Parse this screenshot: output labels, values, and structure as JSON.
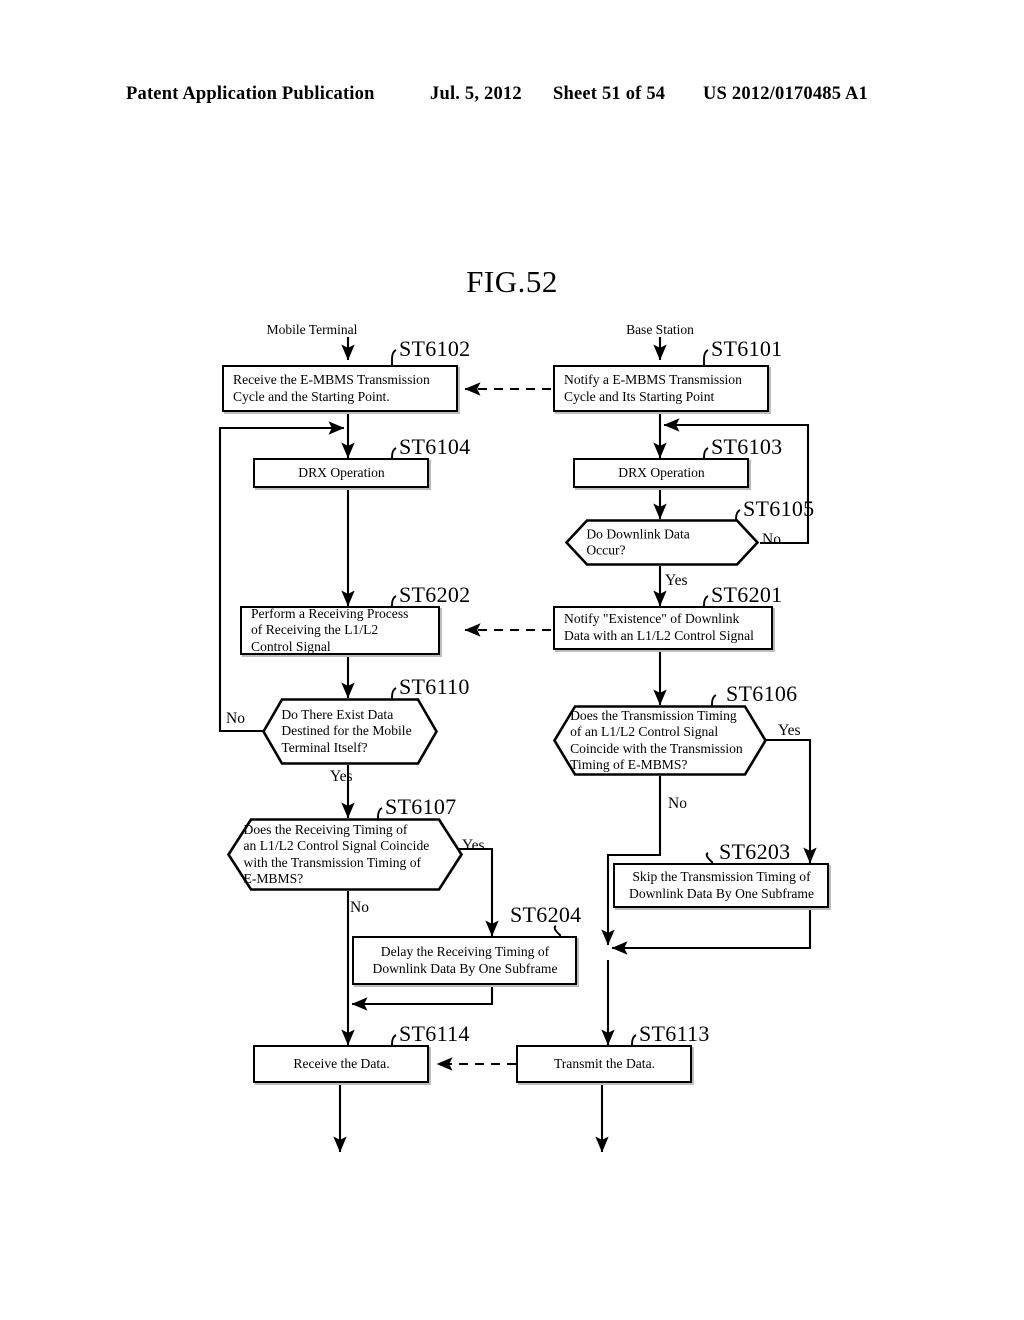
{
  "header": {
    "publication": "Patent Application Publication",
    "date": "Jul. 5, 2012",
    "sheet": "Sheet 51 of 54",
    "number": "US 2012/0170485 A1"
  },
  "figure": {
    "title": "FIG.52"
  },
  "lanes": [
    {
      "id": "mobile-terminal",
      "label": "Mobile Terminal"
    },
    {
      "id": "base-station",
      "label": "Base Station"
    }
  ],
  "nodes": [
    {
      "id": "st6102",
      "ref": "ST6102",
      "shape": "process",
      "lane": "mobile-terminal",
      "text": "Receive the E-MBMS Transmission\nCycle and the Starting Point."
    },
    {
      "id": "st6101",
      "ref": "ST6101",
      "shape": "process",
      "lane": "base-station",
      "text": "Notify a E-MBMS Transmission\nCycle and Its Starting Point"
    },
    {
      "id": "st6104",
      "ref": "ST6104",
      "shape": "process",
      "lane": "mobile-terminal",
      "text": "DRX Operation"
    },
    {
      "id": "st6103",
      "ref": "ST6103",
      "shape": "process",
      "lane": "base-station",
      "text": "DRX Operation"
    },
    {
      "id": "st6105",
      "ref": "ST6105",
      "shape": "decision",
      "lane": "base-station",
      "text": "Do Downlink Data\nOccur?"
    },
    {
      "id": "st6202",
      "ref": "ST6202",
      "shape": "process",
      "lane": "mobile-terminal",
      "text": "Perform a Receiving Process\nof Receiving the L1/L2\nControl Signal"
    },
    {
      "id": "st6201",
      "ref": "ST6201",
      "shape": "process",
      "lane": "base-station",
      "text": "Notify \"Existence\" of Downlink\nData with an L1/L2 Control Signal"
    },
    {
      "id": "st6110",
      "ref": "ST6110",
      "shape": "decision",
      "lane": "mobile-terminal",
      "text": "Do There Exist Data\nDestined for the Mobile\nTerminal Itself?"
    },
    {
      "id": "st6106",
      "ref": "ST6106",
      "shape": "decision",
      "lane": "base-station",
      "text": "Does the Transmission Timing\nof an L1/L2 Control Signal\nCoincide with the Transmission\nTiming of E-MBMS?"
    },
    {
      "id": "st6107",
      "ref": "ST6107",
      "shape": "decision",
      "lane": "mobile-terminal",
      "text": "Does the Receiving Timing of\nan L1/L2 Control Signal Coincide\nwith the Transmission Timing of\nE-MBMS?"
    },
    {
      "id": "st6203",
      "ref": "ST6203",
      "shape": "process",
      "lane": "base-station",
      "text": "Skip the Transmission Timing of\nDownlink Data By One Subframe"
    },
    {
      "id": "st6204",
      "ref": "ST6204",
      "shape": "process",
      "lane": "mobile-terminal",
      "text": "Delay the Receiving Timing of\nDownlink Data By One Subframe"
    },
    {
      "id": "st6114",
      "ref": "ST6114",
      "shape": "process",
      "lane": "mobile-terminal",
      "text": "Receive the Data."
    },
    {
      "id": "st6113",
      "ref": "ST6113",
      "shape": "process",
      "lane": "base-station",
      "text": "Transmit the Data."
    }
  ],
  "edge_labels": [
    {
      "id": "st6105-no",
      "from": "st6105",
      "text": "No"
    },
    {
      "id": "st6105-yes",
      "from": "st6105",
      "text": "Yes"
    },
    {
      "id": "st6110-no",
      "from": "st6110",
      "text": "No"
    },
    {
      "id": "st6110-yes",
      "from": "st6110",
      "text": "Yes"
    },
    {
      "id": "st6106-yes",
      "from": "st6106",
      "text": "Yes"
    },
    {
      "id": "st6106-no",
      "from": "st6106",
      "text": "No"
    },
    {
      "id": "st6107-yes",
      "from": "st6107",
      "text": "Yes"
    },
    {
      "id": "st6107-no",
      "from": "st6107",
      "text": "No"
    }
  ],
  "colors": {
    "ink": "#000000",
    "paper": "#ffffff",
    "shadow": "#bdbdbd"
  }
}
